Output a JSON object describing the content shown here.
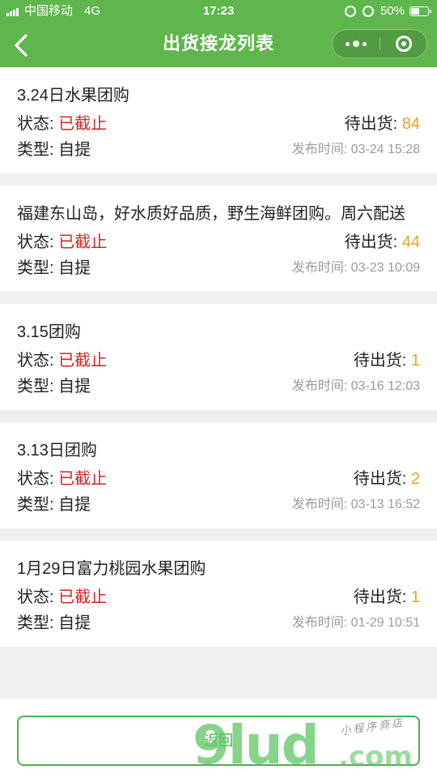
{
  "status_bar": {
    "carrier": "中国移动",
    "network": "4G",
    "time": "17:23",
    "battery": "50%",
    "battery_level": 0.5
  },
  "nav": {
    "title": "出货接龙列表",
    "back_icon": "chevron-left-icon",
    "more_icon": "more-dots-icon",
    "close_icon": "target-circle-icon"
  },
  "labels": {
    "status": "状态:",
    "type": "类型:",
    "pending": "待出货:",
    "publish_time": "发布时间:"
  },
  "items": [
    {
      "title": "3.24日水果团购",
      "status": "已截止",
      "type": "自提",
      "pending": "84",
      "published": "03-24 15:28"
    },
    {
      "title": "福建东山岛，好水质好品质，野生海鲜团购。周六配送",
      "status": "已截止",
      "type": "自提",
      "pending": "44",
      "published": "03-23 10:09"
    },
    {
      "title": "3.15团购",
      "status": "已截止",
      "type": "自提",
      "pending": "1",
      "published": "03-16 12:03"
    },
    {
      "title": "3.13日团购",
      "status": "已截止",
      "type": "自提",
      "pending": "2",
      "published": "03-13 16:52"
    },
    {
      "title": "1月29日富力桃园水果团购",
      "status": "已截止",
      "type": "自提",
      "pending": "1",
      "published": "01-29 10:51"
    }
  ],
  "bottom": {
    "back_label": "返回"
  },
  "watermark": {
    "big": "9lud",
    "com": ".com",
    "small": "小程序商店"
  },
  "colors": {
    "brand_green": "#5fb64d",
    "closed_red": "#d02626",
    "count_orange": "#e8a21b"
  }
}
